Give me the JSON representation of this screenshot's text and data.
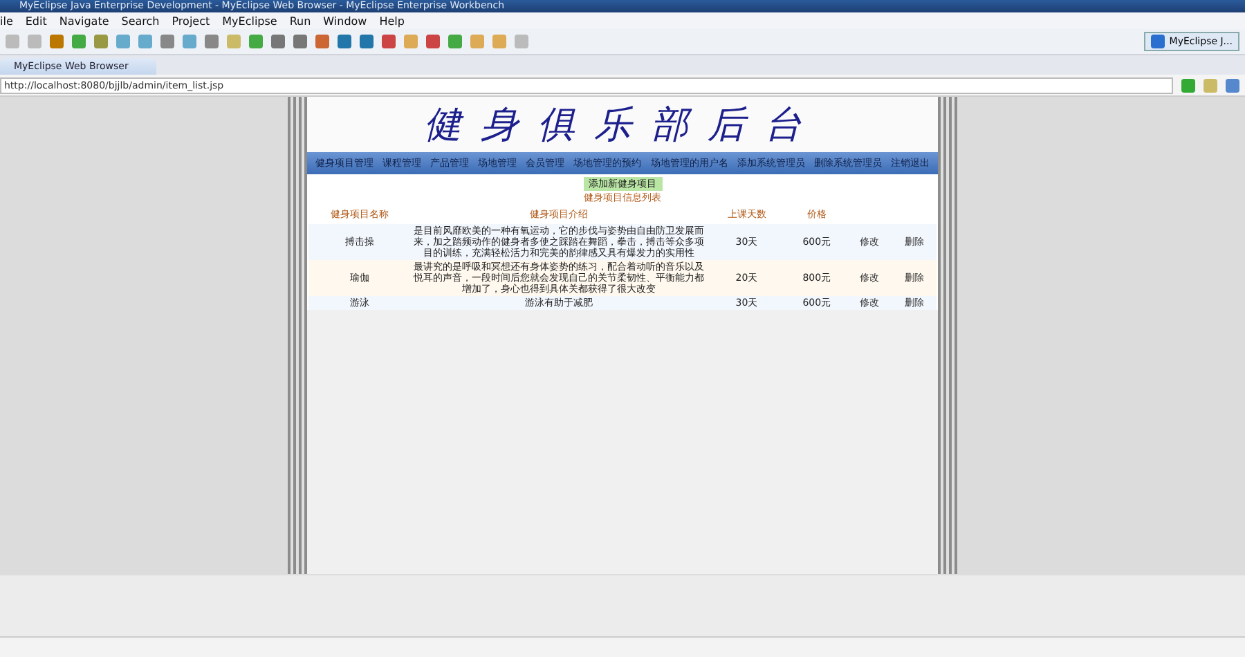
{
  "window": {
    "title": "MyEclipse Java Enterprise Development - MyEclipse Web Browser - MyEclipse Enterprise Workbench"
  },
  "menu": [
    "ile",
    "Edit",
    "Navigate",
    "Search",
    "Project",
    "MyEclipse",
    "Run",
    "Window",
    "Help"
  ],
  "perspective": {
    "label": "MyEclipse J..."
  },
  "editor_tab": {
    "label": "MyEclipse Web Browser",
    "selected": true
  },
  "address": {
    "value": "http://localhost:8080/bjjlb/admin/item_list.jsp"
  },
  "page": {
    "title": "健身俱乐部后台",
    "nav": [
      "健身项目管理",
      "课程管理",
      "产品管理",
      "场地管理",
      "会员管理",
      "场地管理的预约",
      "场地管理的用户名",
      "添加系统管理员",
      "删除系统管理员",
      "注销退出"
    ],
    "add_link": "添加新健身项目",
    "table_caption": "健身项目信息列表",
    "columns": [
      "健身项目名称",
      "健身项目介绍",
      "上课天数",
      "价格"
    ],
    "rows": [
      {
        "name": "搏击操",
        "intro": "是目前风靡欧美的一种有氧运动，它的步伐与姿势由自由防卫发展而来，加之踏频动作的健身者多使之踩踏在舞蹈，拳击，搏击等众多项目的训练，充满轻松活力和完美的韵律感又具有爆发力的实用性",
        "days": "30天",
        "price": "600元",
        "edit": "修改",
        "delete": "删除"
      },
      {
        "name": "瑜伽",
        "intro": "最讲究的是呼吸和冥想还有身体姿势的练习，配合着动听的音乐以及悦耳的声音，一段时间后您就会发现自己的关节柔韧性、平衡能力都增加了，身心也得到具体关都获得了很大改变",
        "days": "20天",
        "price": "800元",
        "edit": "修改",
        "delete": "删除"
      },
      {
        "name": "游泳",
        "intro": "游泳有助于减肥",
        "days": "30天",
        "price": "600元",
        "edit": "修改",
        "delete": "删除"
      }
    ]
  }
}
